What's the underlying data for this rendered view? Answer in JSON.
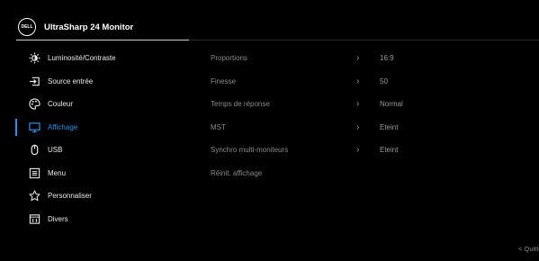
{
  "header": {
    "logo_text": "DELL",
    "title": "UltraSharp 24 Monitor"
  },
  "menu": [
    {
      "label": "Luminosité/Contraste",
      "icon": "brightness-icon"
    },
    {
      "label": "Source entrée",
      "icon": "input-source-icon"
    },
    {
      "label": "Couleur",
      "icon": "color-palette-icon"
    },
    {
      "label": "Affichage",
      "icon": "display-icon",
      "selected": true
    },
    {
      "label": "USB",
      "icon": "usb-icon"
    },
    {
      "label": "Menu",
      "icon": "menu-icon"
    },
    {
      "label": "Personnaliser",
      "icon": "star-icon"
    },
    {
      "label": "Divers",
      "icon": "info-icon"
    }
  ],
  "submenu": [
    {
      "label": "Proportions",
      "chevron": "›",
      "value": "16:9"
    },
    {
      "label": "Finesse",
      "chevron": "›",
      "value": "50"
    },
    {
      "label": "Temps de réponse",
      "chevron": "›",
      "value": "Normal"
    },
    {
      "label": "MST",
      "chevron": "›",
      "value": "Eteint"
    },
    {
      "label": "Synchro multi-moniteurs",
      "chevron": "›",
      "value": "Eteint"
    },
    {
      "label": "Réinit. affichage",
      "chevron": "",
      "value": ""
    }
  ],
  "footer": {
    "quit_label": "< Quitter"
  },
  "colors": {
    "accent": "#2f8fe6",
    "background": "#000000"
  }
}
